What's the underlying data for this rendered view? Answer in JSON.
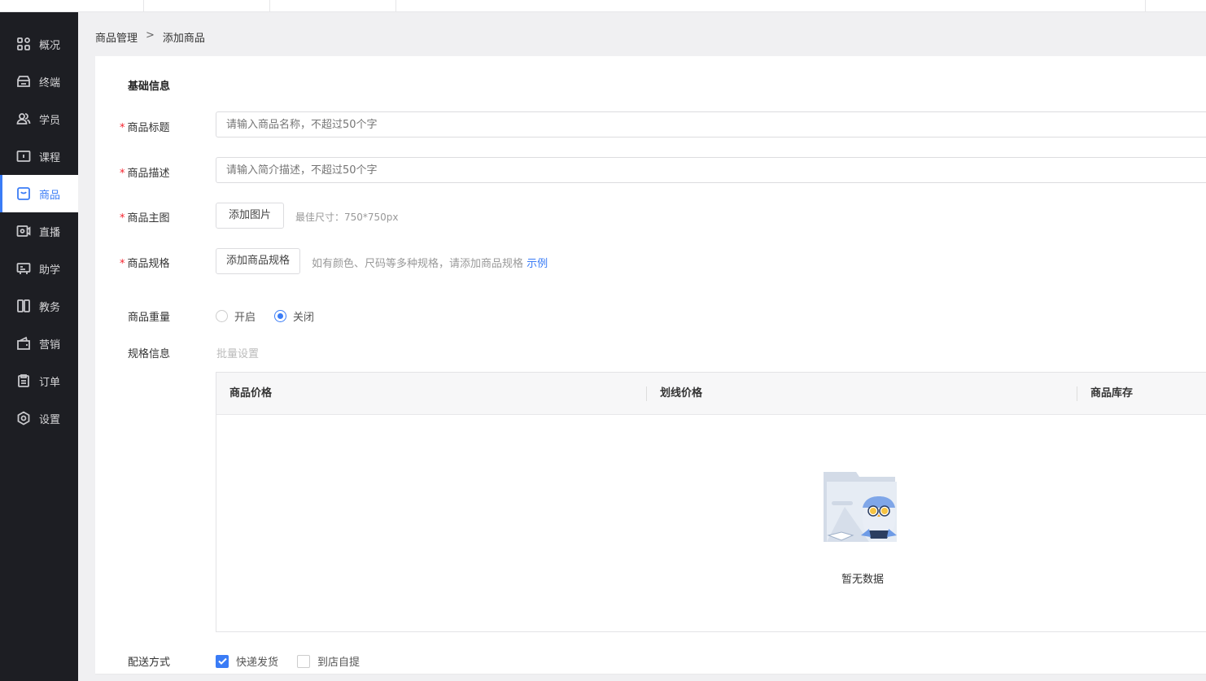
{
  "sidebar": {
    "items": [
      {
        "label": "概况",
        "icon": "grid-icon"
      },
      {
        "label": "终端",
        "icon": "store-icon"
      },
      {
        "label": "学员",
        "icon": "users-icon"
      },
      {
        "label": "课程",
        "icon": "course-icon"
      },
      {
        "label": "商品",
        "icon": "bag-icon",
        "active": true
      },
      {
        "label": "直播",
        "icon": "live-icon"
      },
      {
        "label": "助学",
        "icon": "assist-icon"
      },
      {
        "label": "教务",
        "icon": "book-icon"
      },
      {
        "label": "营销",
        "icon": "wallet-icon"
      },
      {
        "label": "订单",
        "icon": "clipboard-icon"
      },
      {
        "label": "设置",
        "icon": "settings-icon"
      }
    ]
  },
  "breadcrumb": {
    "parent": "商品管理",
    "separator": ">",
    "current": "添加商品"
  },
  "form": {
    "section_title": "基础信息",
    "required_mark": "*",
    "title": {
      "label": "商品标题",
      "placeholder": "请输入商品名称，不超过50个字"
    },
    "desc": {
      "label": "商品描述",
      "placeholder": "请输入简介描述，不超过50个字"
    },
    "image": {
      "label": "商品主图",
      "button": "添加图片",
      "hint": "最佳尺寸：750*750px"
    },
    "spec": {
      "label": "商品规格",
      "button": "添加商品规格",
      "hint": "如有颜色、尺码等多种规格，请添加商品规格",
      "link": "示例"
    },
    "weight": {
      "label": "商品重量",
      "options": [
        "开启",
        "关闭"
      ],
      "selected": "关闭"
    },
    "spec_info": {
      "label": "规格信息",
      "batch": "批量设置"
    },
    "table": {
      "columns": [
        "商品价格",
        "划线价格",
        "商品库存"
      ],
      "empty_text": "暂无数据"
    },
    "delivery": {
      "label": "配送方式",
      "options": [
        {
          "label": "快递发货",
          "checked": true
        },
        {
          "label": "到店自提",
          "checked": false
        }
      ]
    }
  },
  "colors": {
    "accent": "#3a7cf6",
    "sidebar_bg": "#1d1e23",
    "required": "#f5222d"
  }
}
